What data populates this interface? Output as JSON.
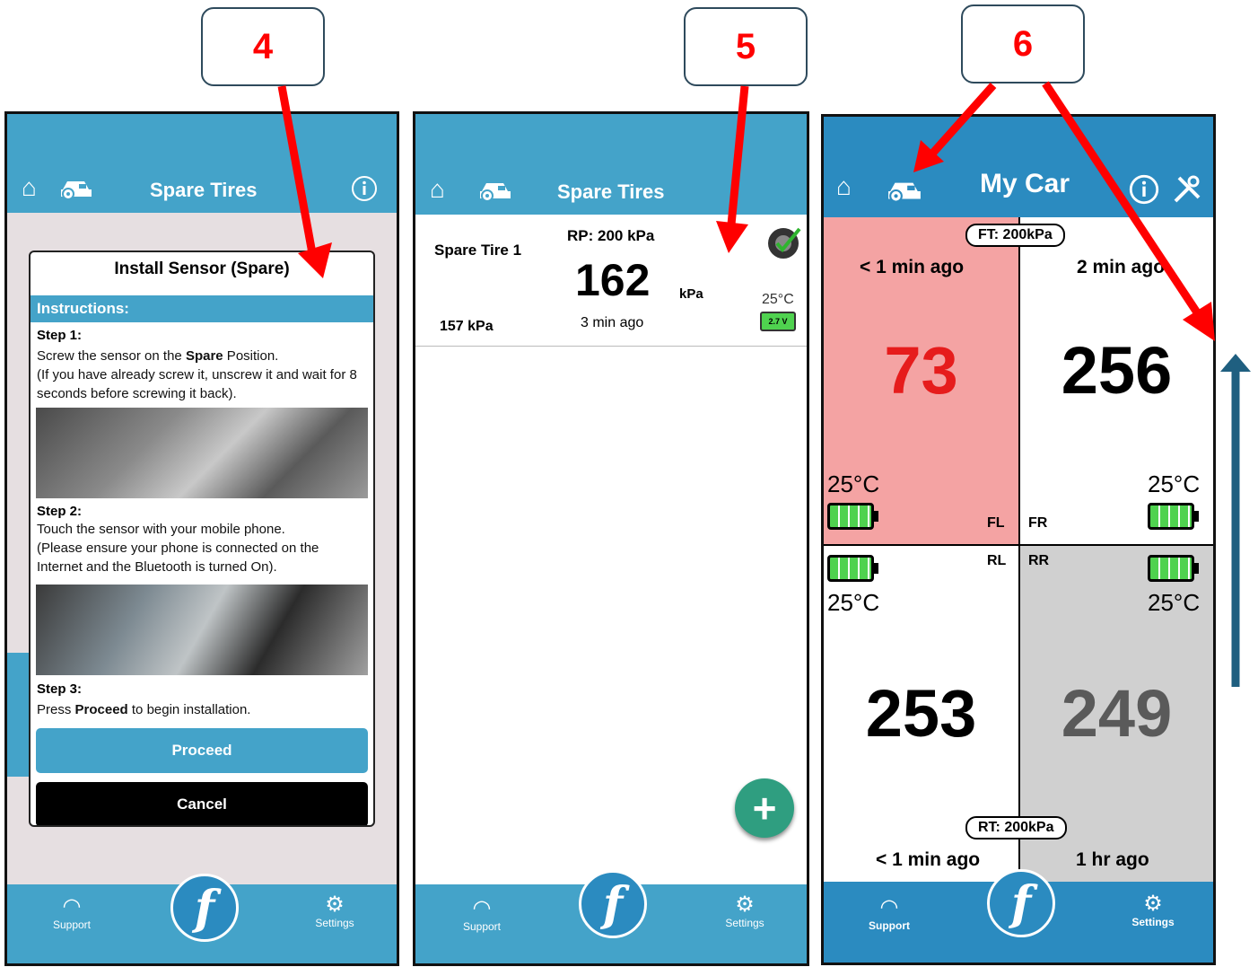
{
  "annotations": {
    "step4": "4",
    "step5": "5",
    "step6": "6"
  },
  "nav": {
    "support": "Support",
    "settings": "Settings",
    "logo": "f"
  },
  "phone1": {
    "title": "Spare Tires",
    "modal": {
      "title": "Install Sensor (Spare)",
      "instructions_label": "Instructions:",
      "step1_heading": "Step 1:",
      "step1_pre": "Screw the sensor on the ",
      "step1_bold": "Spare",
      "step1_post": " Position.",
      "step1_note": "(If you have already screw it, unscrew it and wait for 8 seconds before screwing it back).",
      "step2_heading": "Step 2:",
      "step2_text": "Touch the sensor with your mobile phone.",
      "step2_note": "(Please ensure your phone is connected on the Internet and the Bluetooth is turned On).",
      "step3_heading": "Step 3:",
      "step3_pre": "Press ",
      "step3_bold": "Proceed",
      "step3_post": " to begin installation.",
      "proceed_label": "Proceed",
      "cancel_label": "Cancel"
    }
  },
  "phone2": {
    "title": "Spare Tires",
    "tire": {
      "name": "Spare Tire 1",
      "rp": "RP: 200 kPa",
      "pressure": "162",
      "unit": "kPa",
      "temp": "25°C",
      "battery": "2.7 V",
      "baseline": "157 kPa",
      "ago": "3 min ago"
    },
    "add_button": "+"
  },
  "phone3": {
    "title": "My Car",
    "front_target": "FT: 200kPa",
    "rear_target": "RT: 200kPa",
    "fl": {
      "ago": "< 1 min ago",
      "pressure": "73",
      "temp": "25°C",
      "pos": "FL"
    },
    "fr": {
      "ago": "2 min ago",
      "pressure": "256",
      "temp": "25°C",
      "pos": "FR"
    },
    "rl": {
      "ago": "< 1 min ago",
      "pressure": "253",
      "temp": "25°C",
      "pos": "RL"
    },
    "rr": {
      "ago": "1 hr ago",
      "pressure": "249",
      "temp": "25°C",
      "pos": "RR"
    }
  },
  "colors": {
    "header": "#44a3c9",
    "alert": "#f4a3a3",
    "stale": "#d0d0d0",
    "alert_text": "#e61c1c",
    "stale_text": "#5a5a5a"
  }
}
